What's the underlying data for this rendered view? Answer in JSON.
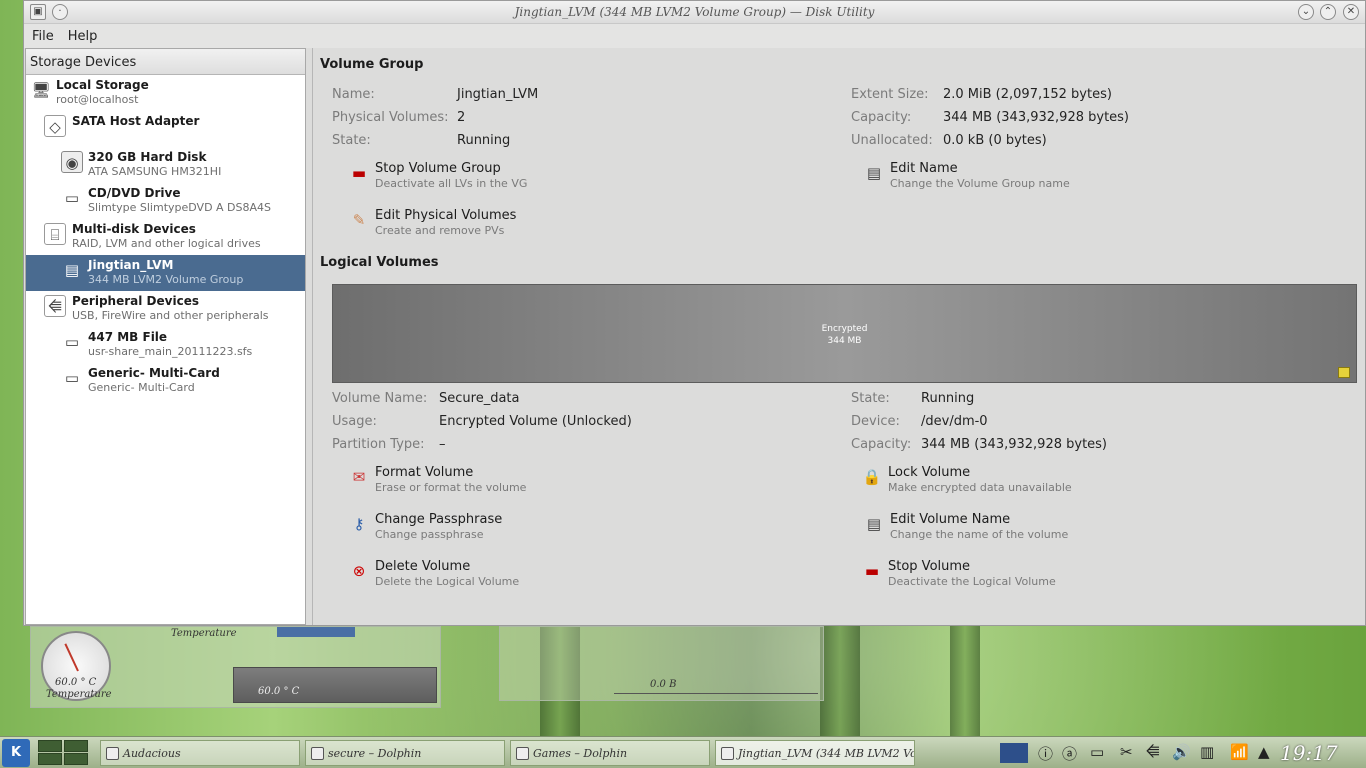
{
  "window": {
    "title": "Jingtian_LVM (344 MB LVM2 Volume Group) — Disk Utility"
  },
  "menu": {
    "file": "File",
    "help": "Help"
  },
  "sidebar": {
    "header": "Storage Devices",
    "items": [
      {
        "name": "Local Storage",
        "sub": "root@localhost",
        "icon": "computer-icon"
      },
      {
        "name": "SATA Host Adapter",
        "sub": "",
        "icon": "adapter-icon"
      },
      {
        "name": "320 GB Hard Disk",
        "sub": "ATA SAMSUNG HM321HI",
        "icon": "hard-disk-icon"
      },
      {
        "name": "CD/DVD Drive",
        "sub": "Slimtype SlimtypeDVD A DS8A4S",
        "icon": "optical-drive-icon"
      },
      {
        "name": "Multi-disk Devices",
        "sub": "RAID, LVM and other logical drives",
        "icon": "multidisk-icon"
      },
      {
        "name": "Jingtian_LVM",
        "sub": "344 MB LVM2 Volume Group",
        "icon": "volume-group-icon"
      },
      {
        "name": "Peripheral Devices",
        "sub": "USB, FireWire and other peripherals",
        "icon": "usb-icon"
      },
      {
        "name": "447 MB File",
        "sub": "usr-share_main_20111223.sfs",
        "icon": "file-disk-icon"
      },
      {
        "name": "Generic- Multi-Card",
        "sub": "Generic- Multi-Card",
        "icon": "card-reader-icon"
      }
    ]
  },
  "volume_group": {
    "title": "Volume Group",
    "name_label": "Name:",
    "name_value": "Jingtian_LVM",
    "pv_label": "Physical Volumes:",
    "pv_value": "2",
    "state_label": "State:",
    "state_value": "Running",
    "extent_label": "Extent Size:",
    "extent_value": "2.0 MiB (2,097,152 bytes)",
    "capacity_label": "Capacity:",
    "capacity_value": "344 MB (343,932,928 bytes)",
    "unalloc_label": "Unallocated:",
    "unalloc_value": "0.0 kB (0 bytes)",
    "actions": {
      "stop": {
        "title": "Stop Volume Group",
        "desc": "Deactivate all LVs in the VG"
      },
      "edit_name": {
        "title": "Edit Name",
        "desc": "Change the Volume Group name"
      },
      "edit_pvs": {
        "title": "Edit Physical Volumes",
        "desc": "Create and remove PVs"
      }
    }
  },
  "logical_volumes": {
    "title": "Logical Volumes",
    "bar_line1": "Encrypted",
    "bar_line2": "344 MB",
    "volname_label": "Volume Name:",
    "volname_value": "Secure_data",
    "usage_label": "Usage:",
    "usage_value": "Encrypted Volume (Unlocked)",
    "ptype_label": "Partition Type:",
    "ptype_value": "–",
    "state_label": "State:",
    "state_value": "Running",
    "device_label": "Device:",
    "device_value": "/dev/dm-0",
    "capacity_label": "Capacity:",
    "capacity_value": "344 MB (343,932,928 bytes)",
    "actions": {
      "format": {
        "title": "Format Volume",
        "desc": "Erase or format the volume"
      },
      "lock": {
        "title": "Lock Volume",
        "desc": "Make encrypted data unavailable"
      },
      "passphrase": {
        "title": "Change Passphrase",
        "desc": "Change passphrase"
      },
      "edit_name": {
        "title": "Edit Volume Name",
        "desc": "Change the name of the volume"
      },
      "delete": {
        "title": "Delete Volume",
        "desc": "Delete the Logical Volume"
      },
      "stop": {
        "title": "Stop Volume",
        "desc": "Deactivate the Logical Volume"
      }
    }
  },
  "widgets": {
    "temp_label_top": "Temperature",
    "temp_gauge_value": "60.0 ° C",
    "temp_gauge_label": "Temperature",
    "temp_graph_value": "60.0 ° C",
    "net_value": "0.0 B"
  },
  "taskbar": {
    "tasks": [
      {
        "label": "Audacious"
      },
      {
        "label": "secure – Dolphin"
      },
      {
        "label": "Games – Dolphin"
      },
      {
        "label": "Jingtian_LVM (344 MB LVM2 Vo"
      }
    ],
    "clock": "19:17"
  }
}
